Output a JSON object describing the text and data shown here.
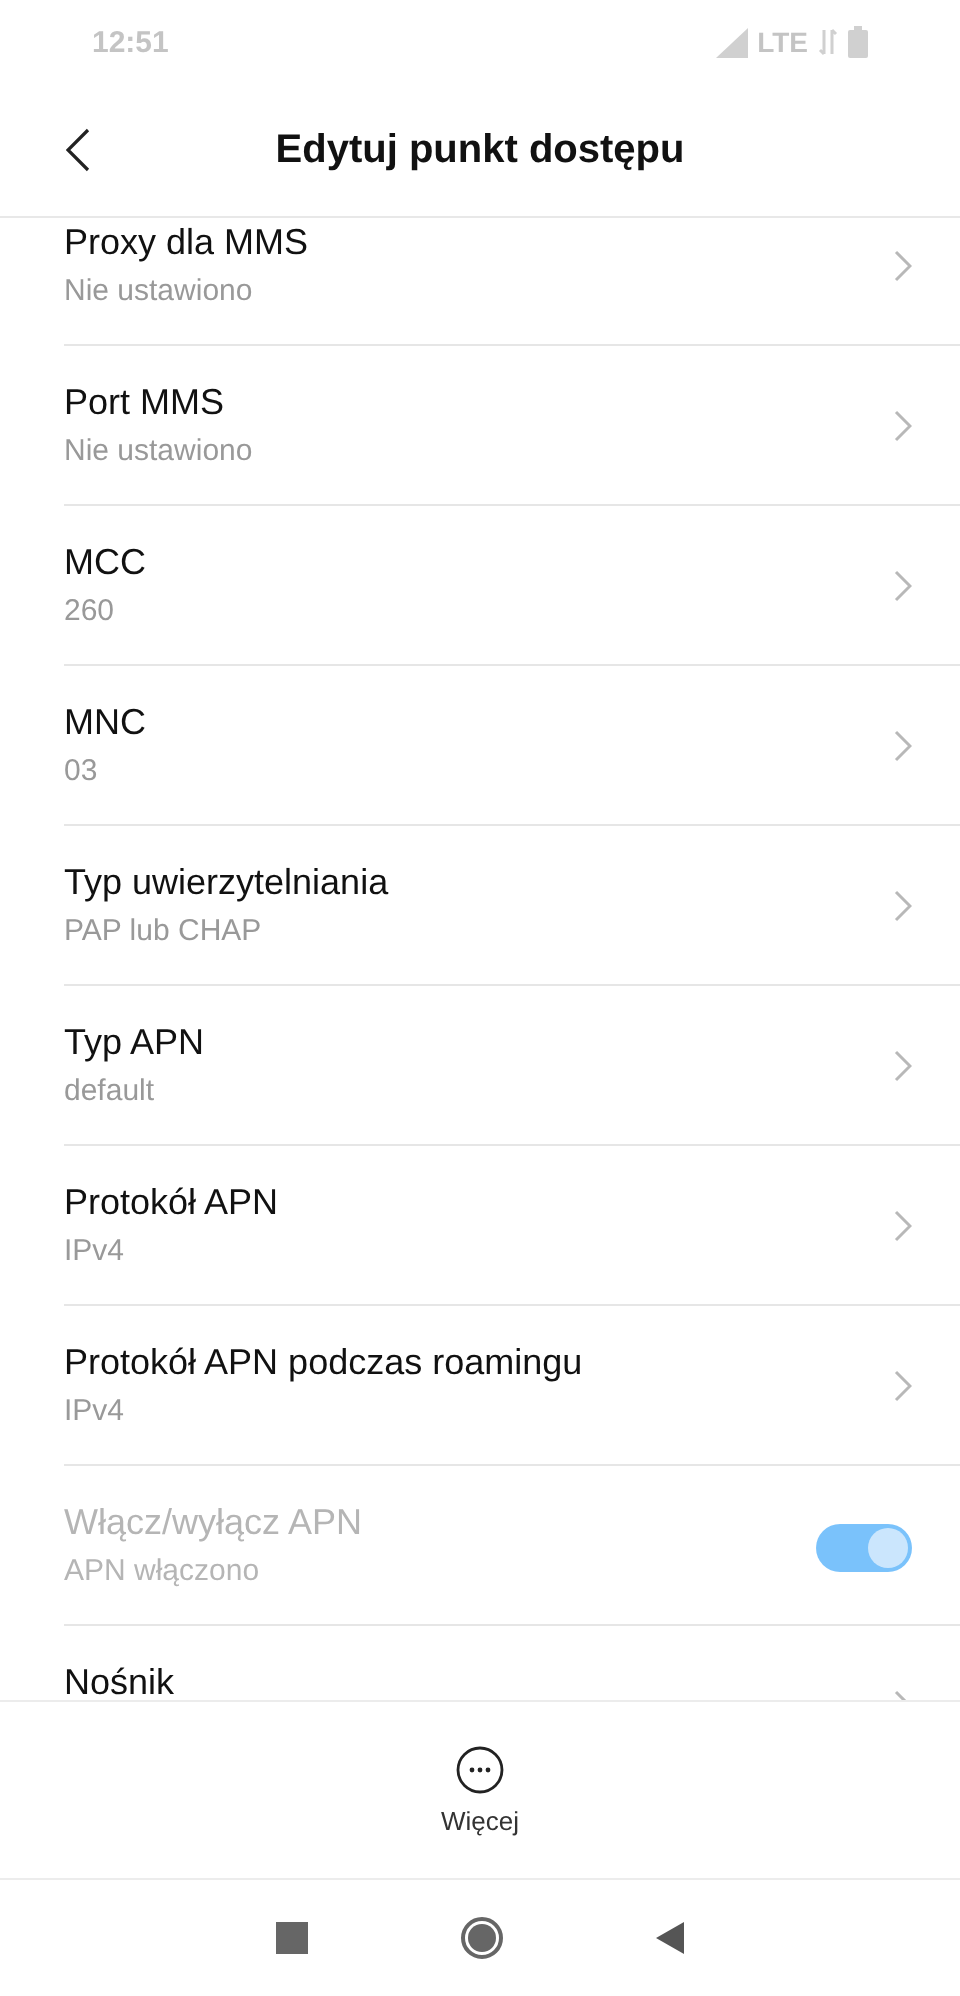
{
  "status_bar": {
    "time": "12:51",
    "network": "LTE"
  },
  "header": {
    "title": "Edytuj punkt dostępu"
  },
  "items": [
    {
      "kind": "link",
      "title": "Proxy dla MMS",
      "value": "Nie ustawiono",
      "disabled": false
    },
    {
      "kind": "link",
      "title": "Port MMS",
      "value": "Nie ustawiono",
      "disabled": false
    },
    {
      "kind": "link",
      "title": "MCC",
      "value": "260",
      "disabled": false
    },
    {
      "kind": "link",
      "title": "MNC",
      "value": "03",
      "disabled": false
    },
    {
      "kind": "link",
      "title": "Typ uwierzytelniania",
      "value": "PAP lub CHAP",
      "disabled": false
    },
    {
      "kind": "link",
      "title": "Typ APN",
      "value": "default",
      "disabled": false
    },
    {
      "kind": "link",
      "title": "Protokół APN",
      "value": "IPv4",
      "disabled": false
    },
    {
      "kind": "link",
      "title": "Protokół APN podczas roamingu",
      "value": "IPv4",
      "disabled": false
    },
    {
      "kind": "toggle",
      "title": "Włącz/wyłącz APN",
      "value": "APN włączono",
      "disabled": true,
      "on": true
    },
    {
      "kind": "link",
      "title": "Nośnik",
      "disabled": false
    }
  ],
  "bottom_action": {
    "label": "Więcej"
  }
}
